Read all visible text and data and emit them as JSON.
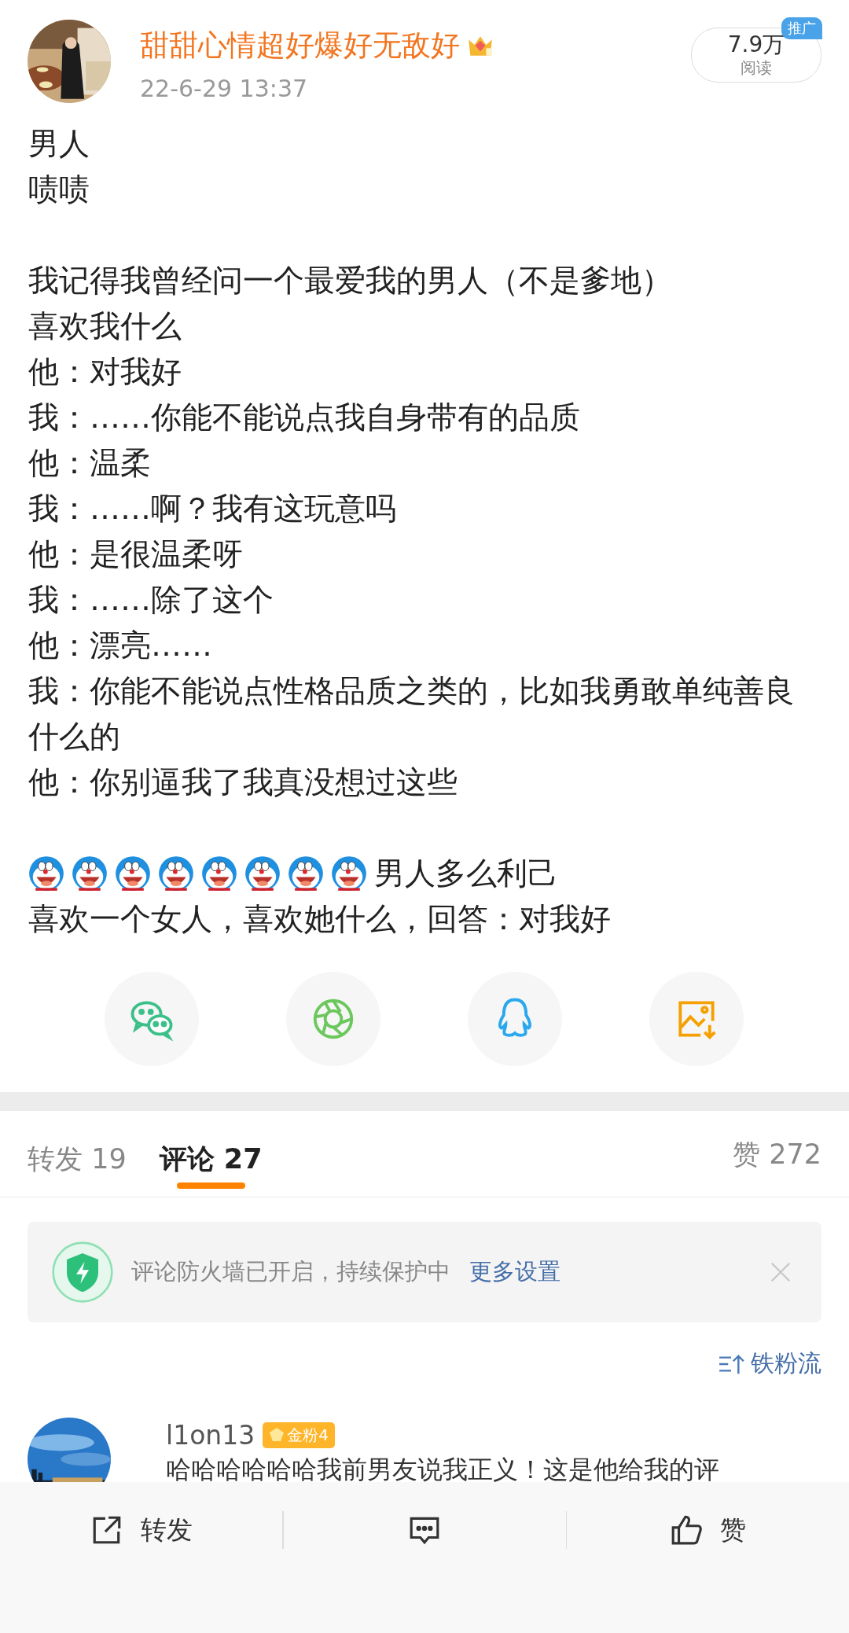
{
  "post": {
    "author": "甜甜心情超好爆好无敌好",
    "date": "22-6-29 13:37",
    "reads": {
      "count": "7.9万",
      "label": "阅读",
      "badge": "推广"
    },
    "paragraphs": [
      {
        "lines": [
          "男人",
          "啧啧"
        ]
      },
      {
        "lines": [
          "我记得我曾经问一个最爱我的男人（不是爹地）",
          "喜欢我什么",
          "他：对我好",
          "我：……你能不能说点我自身带有的品质",
          "他：温柔",
          "我：……啊？我有这玩意吗",
          "他：是很温柔呀",
          "我：……除了这个",
          "他：漂亮……",
          "我：你能不能说点性格品质之类的，比如我勇敢单纯善良什么的",
          "他：你别逼我了我真没想过这些"
        ]
      }
    ],
    "emoji_line": {
      "emojis": [
        {
          "kind": "doraemon"
        },
        {
          "kind": "doraemon"
        },
        {
          "kind": "doraemon"
        },
        {
          "kind": "doraemon"
        },
        {
          "kind": "doraemon"
        },
        {
          "kind": "doraemon"
        },
        {
          "kind": "doraemon"
        },
        {
          "kind": "doraemon"
        }
      ],
      "text": "男人多么利己"
    },
    "last_line": "喜欢一个女人，喜欢她什么，回答：对我好"
  },
  "share": [
    {
      "kind": "wechat"
    },
    {
      "kind": "moments"
    },
    {
      "kind": "qq"
    },
    {
      "kind": "save_image"
    }
  ],
  "tabs": [
    {
      "label": "转发",
      "count": "19",
      "selected": false
    },
    {
      "label": "评论",
      "count": "27",
      "selected": true
    }
  ],
  "likes": {
    "label": "赞",
    "count": "272"
  },
  "firewall": {
    "text": "评论防火墙已开启，持续保护中",
    "link": "更多设置"
  },
  "sort": {
    "label": "铁粉流"
  },
  "comments": [
    {
      "name": "l1on13",
      "badge": "金粉4",
      "text": "哈哈哈哈哈哈我前男友说我正义！这是他给我的评"
    }
  ],
  "bottom_bar": [
    {
      "kind": "repost",
      "label": "转发"
    },
    {
      "kind": "comment"
    },
    {
      "kind": "like",
      "label": "赞"
    }
  ]
}
